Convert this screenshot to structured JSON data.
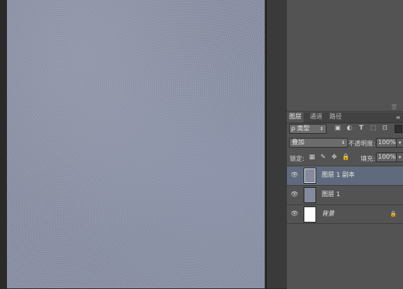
{
  "canvas": {
    "texture_color": "#8e94a8"
  },
  "panel": {
    "tabs": [
      {
        "label": "图层",
        "active": true
      },
      {
        "label": "通道",
        "active": false
      },
      {
        "label": "路径",
        "active": false
      }
    ],
    "filter": {
      "search_glyph": "ρ",
      "value": "类型"
    },
    "filter_icons": [
      "image-filter-icon",
      "adjustment-filter-icon",
      "type-filter-icon",
      "shape-filter-icon",
      "smart-object-filter-icon"
    ],
    "blend_mode": "叠加",
    "opacity_label": "不透明度:",
    "opacity_value": "100%",
    "lock_label": "锁定:",
    "fill_label": "填充:",
    "fill_value": "100%",
    "layers": [
      {
        "name": "图层 1 副本",
        "selected": true,
        "thumb": "texture"
      },
      {
        "name": "图层 1",
        "selected": false,
        "thumb": "texture"
      },
      {
        "name": "背景",
        "selected": false,
        "thumb": "white",
        "locked": true
      }
    ],
    "selection_color": "#5f6a7d"
  }
}
